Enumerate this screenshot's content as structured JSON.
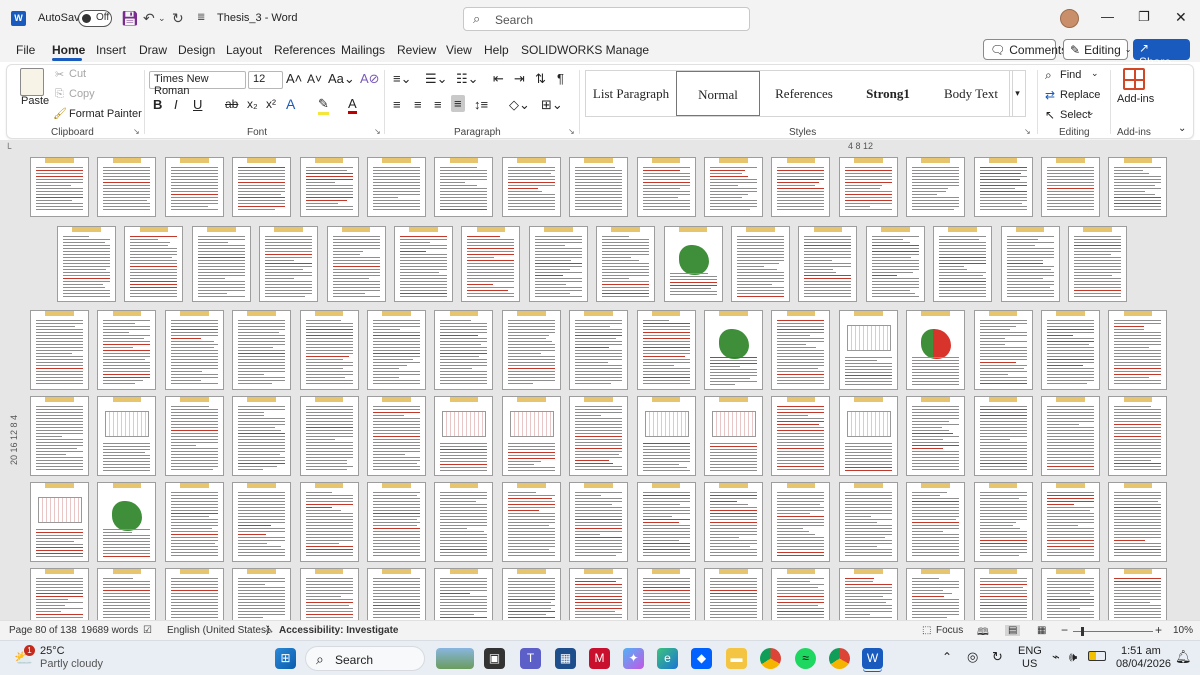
{
  "title_bar": {
    "autosave_label": "AutoSave",
    "autosave_state": "Off",
    "doc_title": "Thesis_3  -  Word",
    "search_placeholder": "Search"
  },
  "menu": {
    "items": [
      "File",
      "Home",
      "Insert",
      "Draw",
      "Design",
      "Layout",
      "References",
      "Mailings",
      "Review",
      "View",
      "Help",
      "SOLIDWORKS Manage"
    ],
    "active": "Home",
    "comments_label": "Comments",
    "editing_label": "Editing",
    "share_label": "Share"
  },
  "ribbon": {
    "clipboard": {
      "paste": "Paste",
      "cut": "Cut",
      "copy": "Copy",
      "format_painter": "Format Painter",
      "label": "Clipboard"
    },
    "font": {
      "name": "Times New Roman",
      "size": "12",
      "label": "Font"
    },
    "paragraph": {
      "label": "Paragraph"
    },
    "styles": {
      "items": [
        "List Paragraph",
        "Normal",
        "References",
        "Strong1",
        "Body Text"
      ],
      "selected": "Normal",
      "label": "Styles"
    },
    "editing": {
      "find": "Find",
      "replace": "Replace",
      "select": "Select",
      "label": "Editing"
    },
    "addins": {
      "button": "Add-ins",
      "label": "Add-ins"
    }
  },
  "ruler": {
    "top": "4   8   12",
    "side": "20 16 12  8   4"
  },
  "status": {
    "page": "Page 80 of 138",
    "words": "19689 words",
    "language": "English (United States)",
    "accessibility": "Accessibility: Investigate",
    "focus": "Focus",
    "zoom": "10%",
    "zoom_fraction": 0.1
  },
  "taskbar": {
    "temperature": "25°C",
    "weather": "Partly cloudy",
    "weather_badge": "1",
    "search": "Search",
    "lang_top": "ENG",
    "lang_bottom": "US",
    "time": "1:51 am",
    "date": "08/04/2026"
  },
  "colors": {
    "accent": "#185abd",
    "spelling": "#c0392b",
    "map_green": "#3f8f3a",
    "map_red": "#d8342c"
  }
}
